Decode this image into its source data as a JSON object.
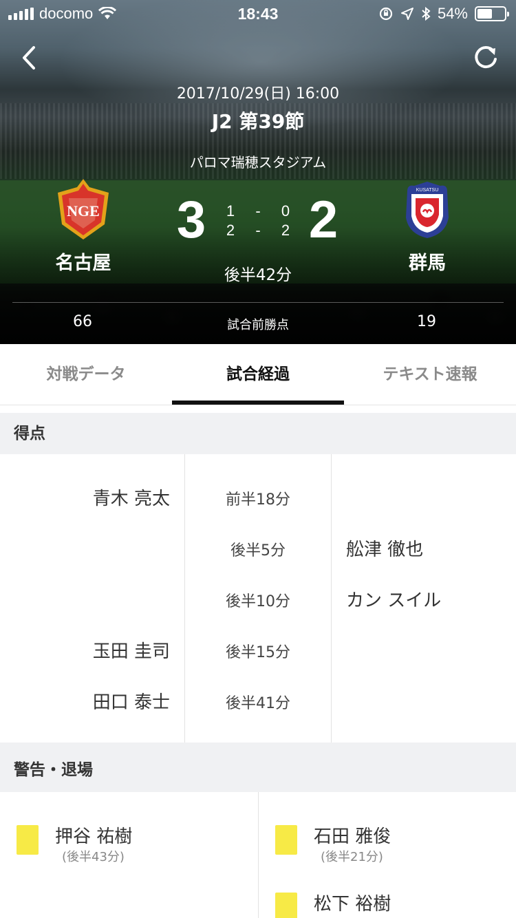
{
  "status_bar": {
    "carrier": "docomo",
    "time": "18:43",
    "battery": "54%",
    "battery_level": 0.54
  },
  "match": {
    "datetime": "2017/10/29(日) 16:00",
    "round": "J2 第39節",
    "venue": "パロマ瑞穂スタジアム",
    "status": "後半42分",
    "points_label": "試合前勝点",
    "home": {
      "name": "名古屋",
      "crest_text": "NGE",
      "score": "3",
      "first_half": "1",
      "second_half": "2",
      "points": "66"
    },
    "away": {
      "name": "群馬",
      "crest_text": "KUSATSU",
      "score": "2",
      "first_half": "0",
      "second_half": "2",
      "points": "19"
    },
    "half_sep": "-"
  },
  "tabs": [
    {
      "label": "対戦データ",
      "active": false
    },
    {
      "label": "試合経過",
      "active": true
    },
    {
      "label": "テキスト速報",
      "active": false
    }
  ],
  "goals": {
    "title": "得点",
    "rows": [
      {
        "home": "青木 亮太",
        "time": "前半18分",
        "away": ""
      },
      {
        "home": "",
        "time": "後半5分",
        "away": "舩津 徹也"
      },
      {
        "home": "",
        "time": "後半10分",
        "away": "カン スイル"
      },
      {
        "home": "玉田 圭司",
        "time": "後半15分",
        "away": ""
      },
      {
        "home": "田口 泰士",
        "time": "後半41分",
        "away": ""
      }
    ]
  },
  "cards": {
    "title": "警告・退場",
    "home": [
      {
        "player": "押谷 祐樹",
        "time": "(後半43分)",
        "type": "yellow"
      }
    ],
    "away": [
      {
        "player": "石田 雅俊",
        "time": "(後半21分)",
        "type": "yellow"
      },
      {
        "player": "松下 裕樹",
        "time": "",
        "type": "yellow"
      }
    ]
  },
  "colors": {
    "yellow_card": "#f7ea46",
    "home_crest_red": "#d8342a",
    "home_crest_gold": "#e3a21a",
    "away_crest_blue": "#2c3f96",
    "away_crest_red": "#d9262e"
  },
  "icons": [
    "wifi-icon",
    "orientation-lock-icon",
    "location-icon",
    "bluetooth-icon",
    "back-chevron-icon",
    "refresh-icon"
  ]
}
